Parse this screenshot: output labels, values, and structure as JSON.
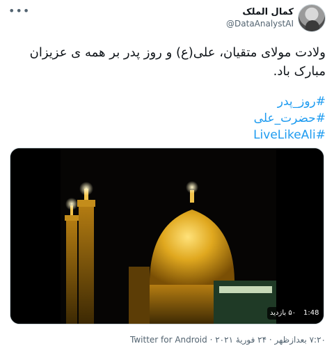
{
  "header": {
    "display_name": "کمال الملک",
    "handle": "@DataAnalystAI",
    "more_label": "•••"
  },
  "tweet": {
    "text_line1": "ولادت مولای متقیان، علی(ع) و روز پدر بر همه ی عزیزان",
    "text_line2": "مبارک باد.",
    "hashtags": [
      "#روز_پدر",
      "#حضرت_علی",
      "#LiveLikeAli"
    ]
  },
  "media": {
    "duration": "1:48",
    "views": "۵۰ بازدید"
  },
  "meta": {
    "time": "۷:۲۰ بعدازظهر",
    "date": "۲۴ فوریهٔ ۲۰۲۱",
    "source": "Twitter for Android",
    "separator": "·"
  },
  "colors": {
    "link": "#1d9bf0",
    "secondary_text": "#536471",
    "dome_gold": "#d4a017"
  }
}
